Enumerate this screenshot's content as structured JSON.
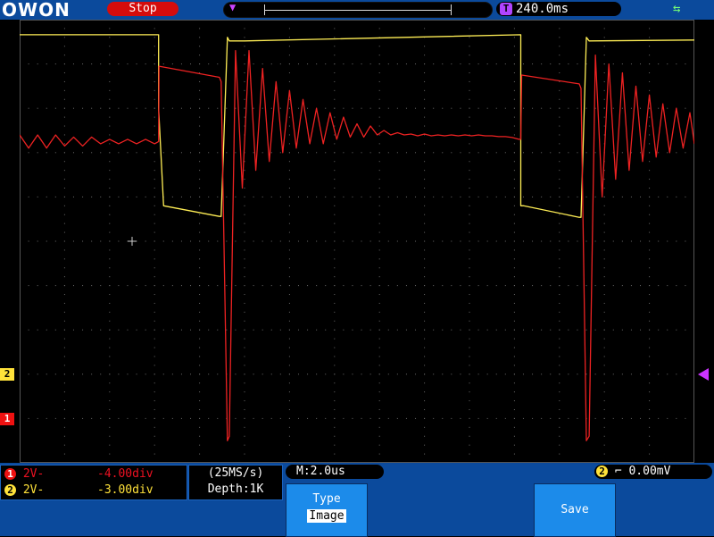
{
  "top": {
    "logo": "OWON",
    "run_state": "Stop",
    "time_base_badge": "T",
    "trigger_position_time": "240.0ms",
    "colors": {
      "bar": "#0b4a9c",
      "stop": "#d50c0c",
      "trig": "#b044ff"
    },
    "icons": {
      "usb": "usb-icon",
      "trigger_pos": "trigger-position-icon"
    }
  },
  "markers": {
    "ch2_badge": "2",
    "ch1_badge": "1"
  },
  "bottom": {
    "ch1": {
      "badge": "1",
      "scale": "2V",
      "offset": "-4.00div"
    },
    "ch2": {
      "badge": "2",
      "scale": "2V",
      "offset": "-3.00div"
    },
    "sampling": {
      "rate": "(25MS/s)",
      "depth": "Depth:1K"
    },
    "time_div": "M:2.0us",
    "trigger": {
      "channel": "2",
      "edge_icon": "rising-edge-icon",
      "level": "0.00mV"
    },
    "menu": {
      "type_label": "Type",
      "type_value": "Image",
      "save_label": "Save"
    }
  },
  "chart_data": {
    "type": "line",
    "title": "",
    "xlabel": "",
    "ylabel": "",
    "grid": true,
    "divisions": {
      "x": 15,
      "y": 10
    },
    "x_unit": "div",
    "y_unit": "div",
    "series": [
      {
        "channel": 2,
        "color": "#ffee55",
        "x": [
          0,
          3.09,
          3.09,
          3.2,
          4.44,
          4.48,
          4.62,
          4.66,
          5.0,
          11.14,
          11.14,
          11.2,
          12.44,
          12.48,
          12.6,
          12.66,
          15
        ],
        "y": [
          9.66,
          9.66,
          8.0,
          5.8,
          5.56,
          5.56,
          9.6,
          9.52,
          9.52,
          9.66,
          5.8,
          5.8,
          5.54,
          5.54,
          9.6,
          9.52,
          9.54
        ]
      },
      {
        "channel": 1,
        "color": "#ee2222",
        "x": [
          0,
          0.2,
          0.4,
          0.6,
          0.8,
          1.0,
          1.2,
          1.4,
          1.6,
          1.8,
          2.0,
          2.2,
          2.4,
          2.6,
          2.8,
          3.0,
          3.09,
          3.1,
          4.44,
          4.48,
          4.62,
          4.66,
          4.8,
          4.95,
          5.1,
          5.25,
          5.4,
          5.55,
          5.7,
          5.85,
          6.0,
          6.15,
          6.3,
          6.45,
          6.6,
          6.75,
          6.9,
          7.05,
          7.2,
          7.35,
          7.5,
          7.65,
          7.8,
          7.95,
          8.1,
          8.25,
          8.4,
          8.55,
          8.7,
          8.85,
          9.0,
          9.15,
          9.3,
          9.45,
          9.6,
          9.75,
          9.9,
          10.05,
          10.2,
          10.35,
          10.5,
          10.65,
          10.8,
          10.95,
          11.1,
          11.14,
          11.16,
          12.44,
          12.48,
          12.6,
          12.66,
          12.8,
          12.95,
          13.1,
          13.25,
          13.4,
          13.55,
          13.7,
          13.85,
          14.0,
          14.15,
          14.3,
          14.45,
          14.6,
          14.75,
          14.9,
          15
        ],
        "y": [
          7.4,
          7.1,
          7.4,
          7.1,
          7.4,
          7.15,
          7.35,
          7.15,
          7.35,
          7.2,
          7.3,
          7.2,
          7.3,
          7.2,
          7.3,
          7.2,
          7.25,
          8.95,
          8.7,
          8.6,
          0.5,
          0.6,
          9.3,
          6.2,
          9.3,
          6.6,
          8.9,
          6.8,
          8.6,
          7.0,
          8.4,
          7.1,
          8.2,
          7.2,
          8.0,
          7.2,
          7.9,
          7.3,
          7.8,
          7.35,
          7.65,
          7.35,
          7.6,
          7.4,
          7.5,
          7.4,
          7.45,
          7.4,
          7.42,
          7.38,
          7.42,
          7.38,
          7.4,
          7.38,
          7.4,
          7.38,
          7.4,
          7.38,
          7.4,
          7.38,
          7.38,
          7.36,
          7.36,
          7.34,
          7.3,
          7.3,
          8.75,
          8.55,
          8.45,
          0.5,
          0.6,
          9.2,
          6.0,
          9.0,
          6.4,
          8.8,
          6.6,
          8.5,
          6.8,
          8.3,
          6.9,
          8.1,
          7.0,
          8.0,
          7.1,
          7.9,
          7.2
        ]
      }
    ]
  }
}
